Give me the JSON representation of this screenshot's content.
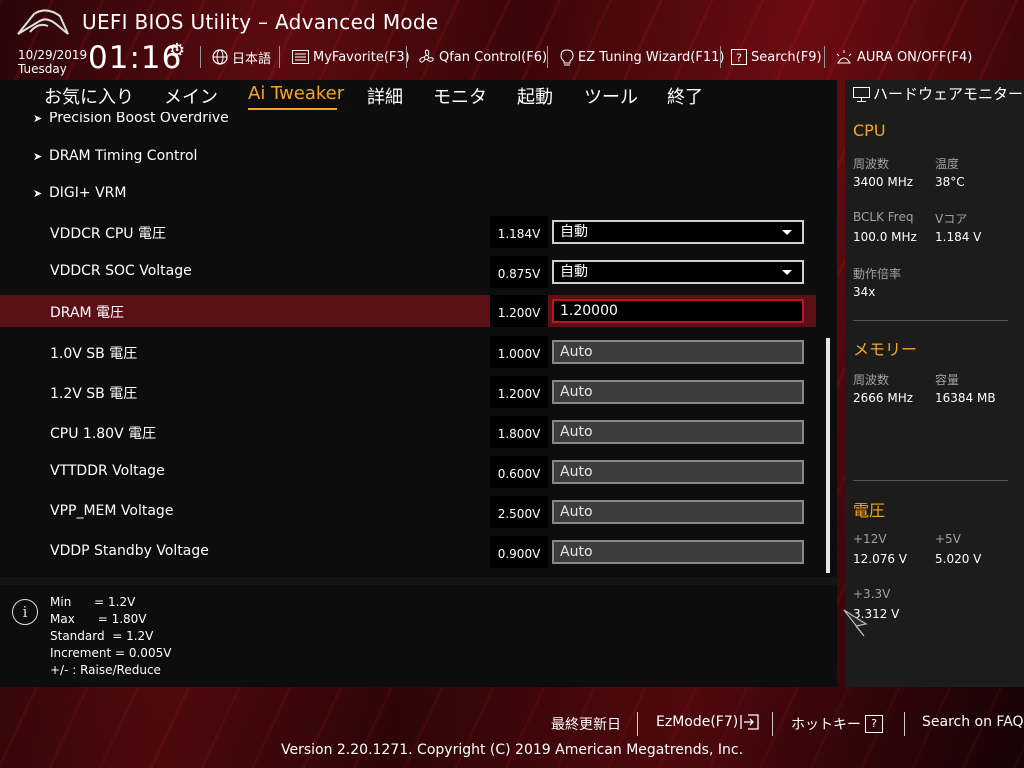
{
  "app": {
    "title": "UEFI BIOS Utility – Advanced Mode",
    "date": "10/29/2019",
    "day": "Tuesday",
    "time": "01:16"
  },
  "toolbar": {
    "language": "日本語",
    "myfavorite": "MyFavorite(F3)",
    "qfan": "Qfan Control(F6)",
    "ez_tuning": "EZ Tuning Wizard(F11)",
    "search": "Search(F9)",
    "aura": "AURA ON/OFF(F4)"
  },
  "nav": {
    "tabs": [
      "お気に入り",
      "メイン",
      "Ai Tweaker",
      "詳細",
      "モニタ",
      "起動",
      "ツール",
      "終了"
    ],
    "active": "Ai Tweaker"
  },
  "submenus": [
    "Precision Boost Overdrive",
    "DRAM Timing Control",
    "DIGI+ VRM"
  ],
  "rows": [
    {
      "label": "VDDCR CPU 電圧",
      "value": "1.184V",
      "setting": "自動",
      "type": "dropdown"
    },
    {
      "label": "VDDCR SOC Voltage",
      "value": "0.875V",
      "setting": "自動",
      "type": "dropdown"
    },
    {
      "label": "DRAM 電圧",
      "value": "1.200V",
      "setting": "1.20000",
      "type": "edit"
    },
    {
      "label": "1.0V SB 電圧",
      "value": "1.000V",
      "setting": "Auto",
      "type": "field"
    },
    {
      "label": "1.2V SB 電圧",
      "value": "1.200V",
      "setting": "Auto",
      "type": "field"
    },
    {
      "label": "CPU 1.80V 電圧",
      "value": "1.800V",
      "setting": "Auto",
      "type": "field"
    },
    {
      "label": "VTTDDR Voltage",
      "value": "0.600V",
      "setting": "Auto",
      "type": "field"
    },
    {
      "label": "VPP_MEM Voltage",
      "value": "2.500V",
      "setting": "Auto",
      "type": "field"
    },
    {
      "label": "VDDP Standby Voltage",
      "value": "0.900V",
      "setting": "Auto",
      "type": "field"
    }
  ],
  "info": {
    "lines": [
      "Min      = 1.2V",
      "Max      = 1.80V",
      "Standard  = 1.2V",
      "Increment = 0.005V",
      "+/- : Raise/Reduce"
    ]
  },
  "hw_monitor": {
    "title": "ハードウェアモニター",
    "cpu": {
      "heading": "CPU",
      "freq_label": "周波数",
      "freq": "3400 MHz",
      "temp_label": "温度",
      "temp": "38°C",
      "bclk_label": "BCLK Freq",
      "bclk": "100.0 MHz",
      "vcore_label": "Vコア",
      "vcore": "1.184 V",
      "ratio_label": "動作倍率",
      "ratio": "34x"
    },
    "memory": {
      "heading": "メモリー",
      "freq_label": "周波数",
      "freq": "2666 MHz",
      "cap_label": "容量",
      "cap": "16384 MB"
    },
    "voltage": {
      "heading": "電圧",
      "v12_label": "+12V",
      "v12": "12.076 V",
      "v5_label": "+5V",
      "v5": "5.020 V",
      "v33_label": "+3.3V",
      "v33": "3.312 V"
    }
  },
  "footer": {
    "last_modified": "最終更新日",
    "ezmode": "EzMode(F7)",
    "hotkeys": "ホットキー",
    "faq": "Search on FAQ",
    "version": "Version 2.20.1271. Copyright (C) 2019 American Megatrends, Inc."
  }
}
